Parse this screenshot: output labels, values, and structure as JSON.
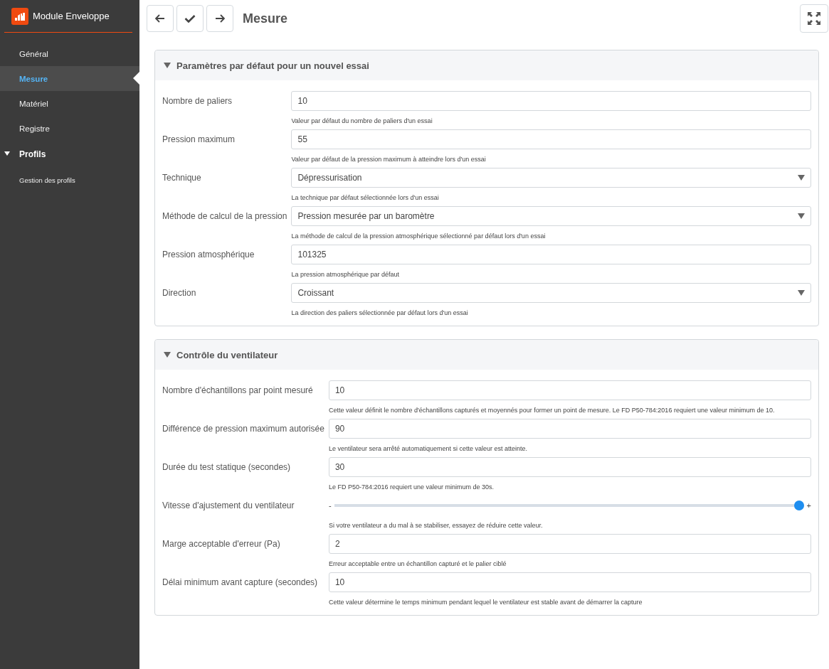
{
  "sidebar": {
    "title": "Module Enveloppe",
    "items": [
      {
        "label": "Général",
        "selected": false
      },
      {
        "label": "Mesure",
        "selected": true
      },
      {
        "label": "Matériel",
        "selected": false
      },
      {
        "label": "Registre",
        "selected": false
      },
      {
        "label": "Profils",
        "expanded": true,
        "children": [
          {
            "label": "Gestion des profils",
            "selected": false
          }
        ]
      }
    ]
  },
  "toolbar": {
    "title": "Mesure"
  },
  "sections": [
    {
      "title": "Paramètres par défaut pour un nouvel essai",
      "expanded": true,
      "fields": [
        {
          "kind": "input",
          "label": "Nombre de paliers",
          "value": "10",
          "help": "Valeur par défaut du nombre de paliers d'un essai"
        },
        {
          "kind": "input",
          "label": "Pression maximum",
          "value": "55",
          "help": "Valeur par défaut de la pression maximum à atteindre lors d'un essai"
        },
        {
          "kind": "select",
          "label": "Technique",
          "value": "Dépressurisation",
          "help": "La technique par défaut sélectionnée lors d'un essai"
        },
        {
          "kind": "select",
          "label": "Méthode de calcul de la pression",
          "value": "Pression mesurée par un baromètre",
          "help": "La méthode de calcul de la pression atmosphérique sélectionné par défaut lors d'un essai"
        },
        {
          "kind": "input",
          "label": "Pression atmosphérique",
          "value": "101325",
          "help": "La pression atmosphérique par défaut"
        },
        {
          "kind": "select",
          "label": "Direction",
          "value": "Croissant",
          "help": "La direction des paliers sélectionnée par défaut lors d'un essai"
        }
      ]
    },
    {
      "title": "Contrôle du ventilateur",
      "expanded": true,
      "fields": [
        {
          "kind": "input",
          "label": "Nombre d'échantillons par point mesuré",
          "value": "10",
          "help": "Cette valeur définit le nombre d'échantillons capturés et moyennés pour former un point de mesure. Le FD P50-784:2016 requiert une valeur minimum de 10."
        },
        {
          "kind": "input",
          "label": "Différence de pression maximum autorisée",
          "value": "90",
          "help": "Le ventilateur sera arrêté automatiquement si cette valeur est atteinte."
        },
        {
          "kind": "input",
          "label": "Durée du test statique (secondes)",
          "value": "30",
          "help": "Le FD P50-784:2016 requiert une valeur minimum de 30s."
        },
        {
          "kind": "slider",
          "label": "Vitesse d'ajustement du ventilateur",
          "min_label": "-",
          "max_label": "+",
          "level": 1,
          "help": "Si votre ventilateur a du mal à se stabiliser, essayez de réduire cette valeur."
        },
        {
          "kind": "input",
          "label": "Marge acceptable d'erreur (Pa)",
          "value": "2",
          "help": "Erreur acceptable entre un échantillon capturé et le palier ciblé"
        },
        {
          "kind": "input",
          "label": "Délai minimum avant capture (secondes)",
          "value": "10",
          "help": "Cette valeur détermine le temps minimum pendant lequel le ventilateur est stable avant de démarrer la capture"
        }
      ]
    }
  ]
}
